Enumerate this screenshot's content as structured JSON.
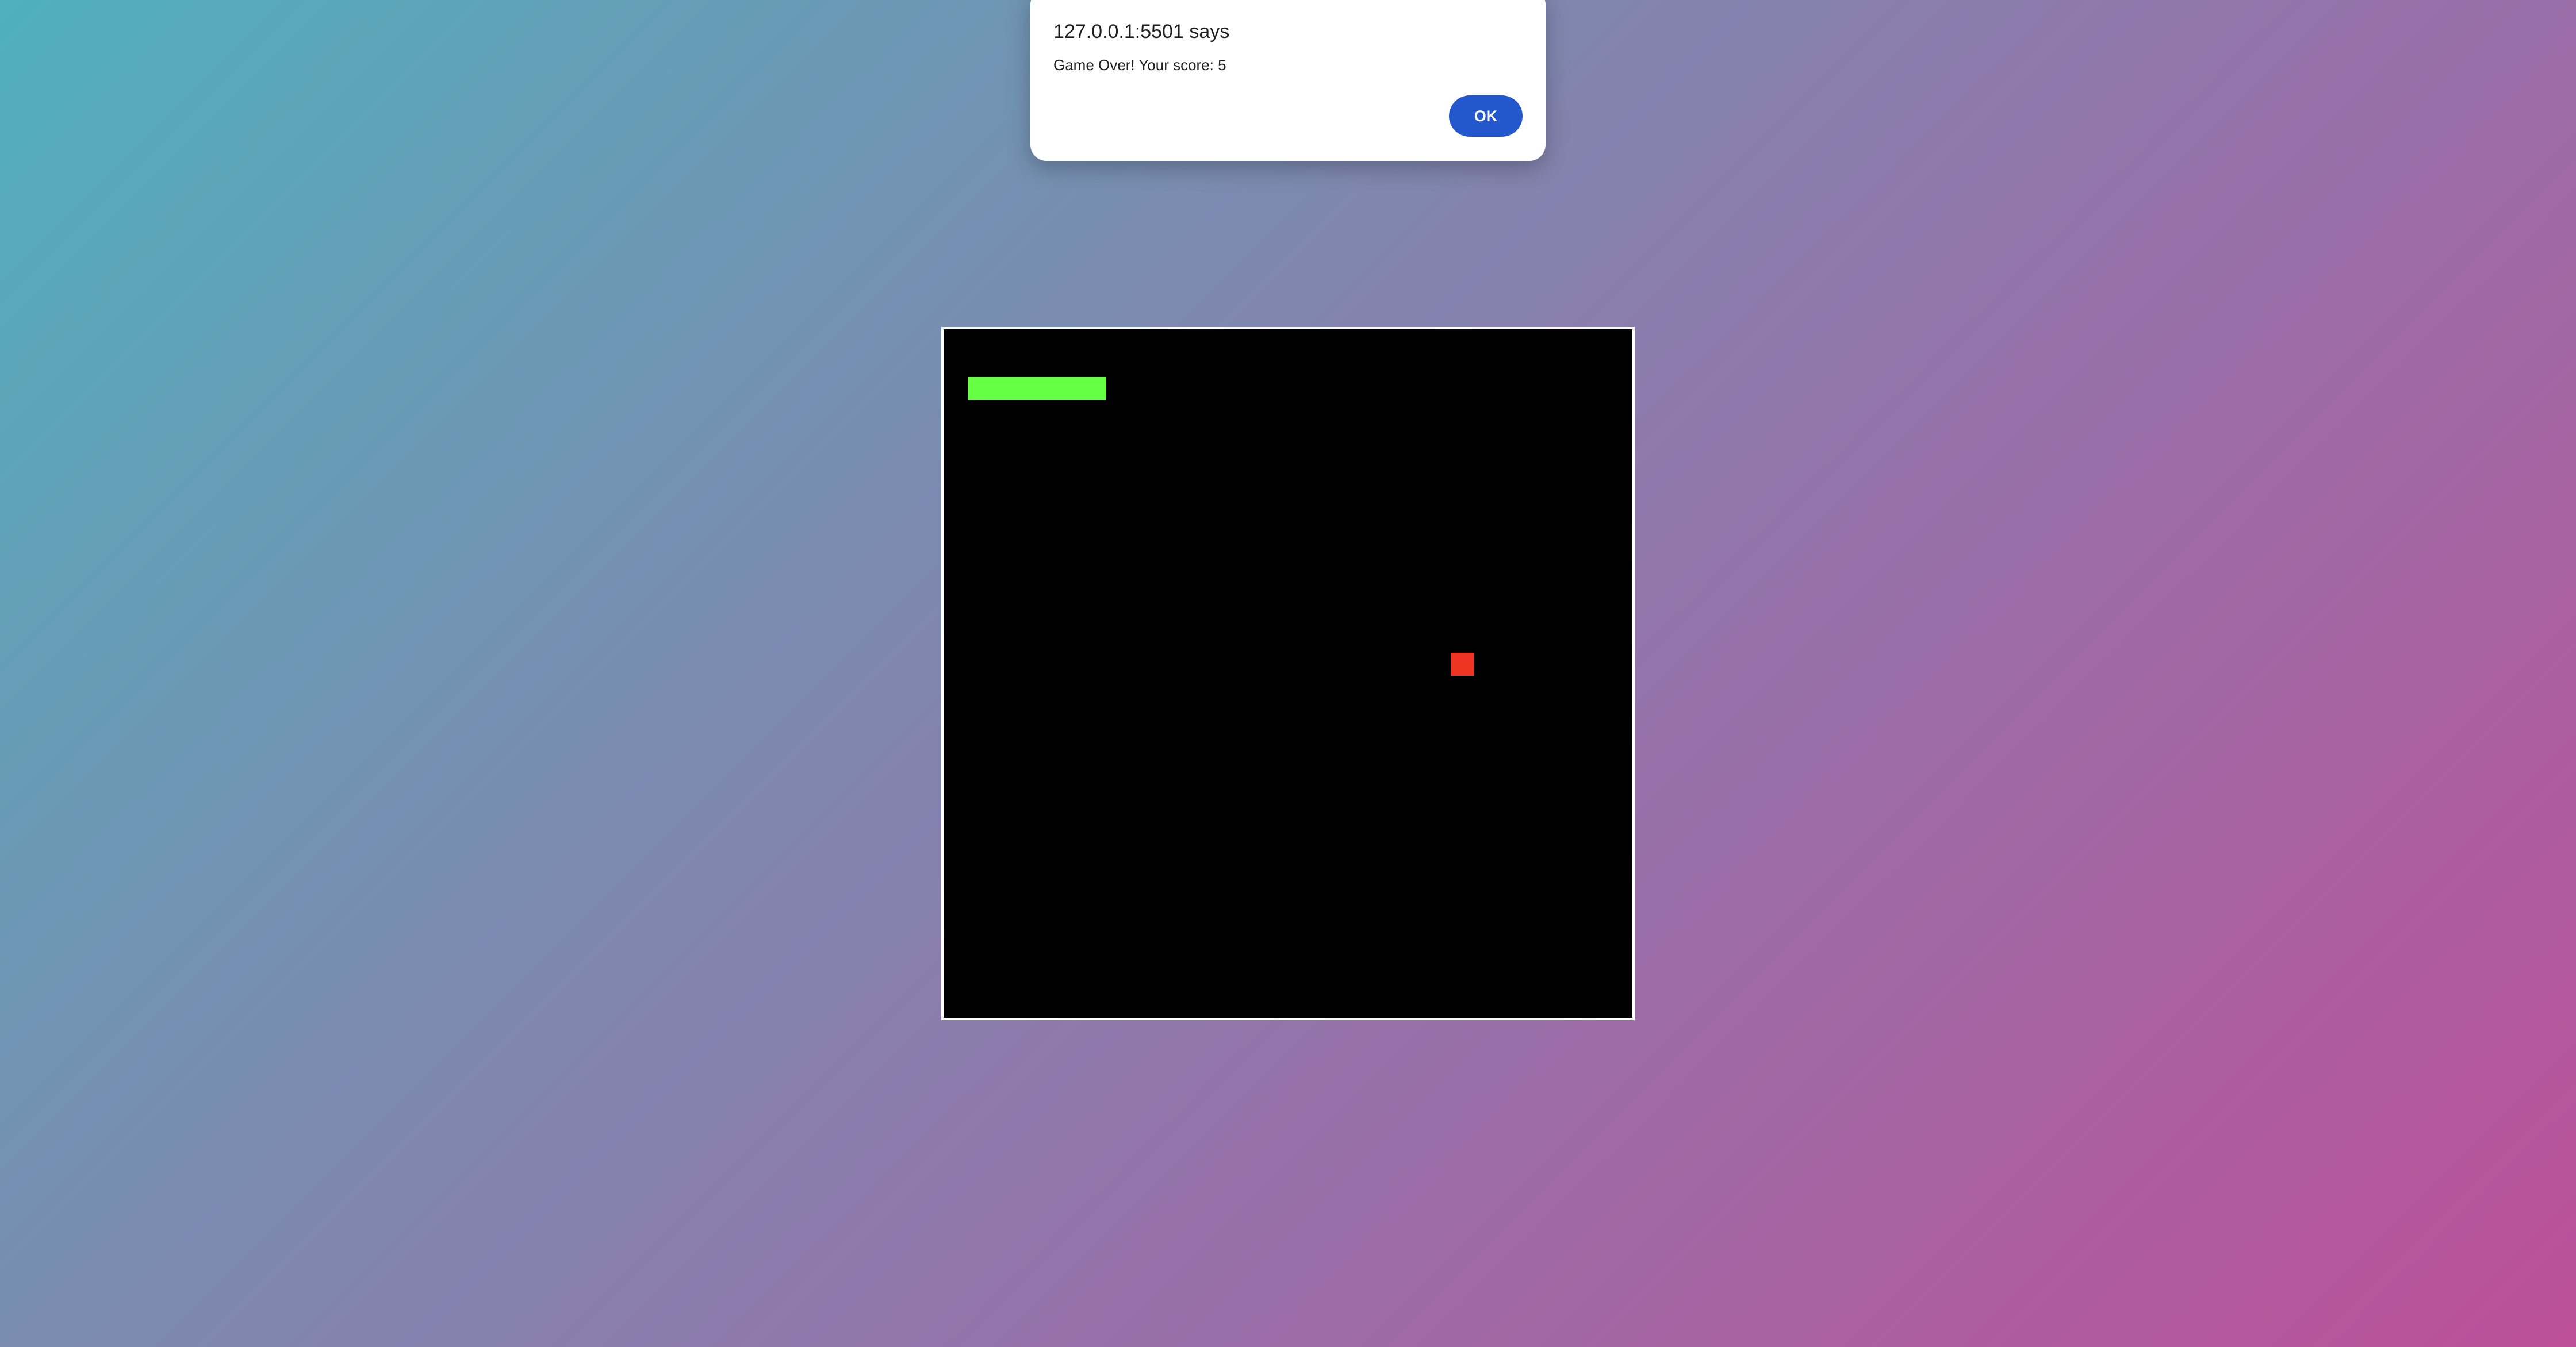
{
  "alert": {
    "title": "127.0.0.1:5501 says",
    "message": "Game Over! Your score: 5",
    "ok_label": "OK"
  },
  "game": {
    "snake_length": 6,
    "colors": {
      "board": "#000000",
      "snake": "#66ff44",
      "food": "#ee3322",
      "border": "#ffffff"
    }
  }
}
